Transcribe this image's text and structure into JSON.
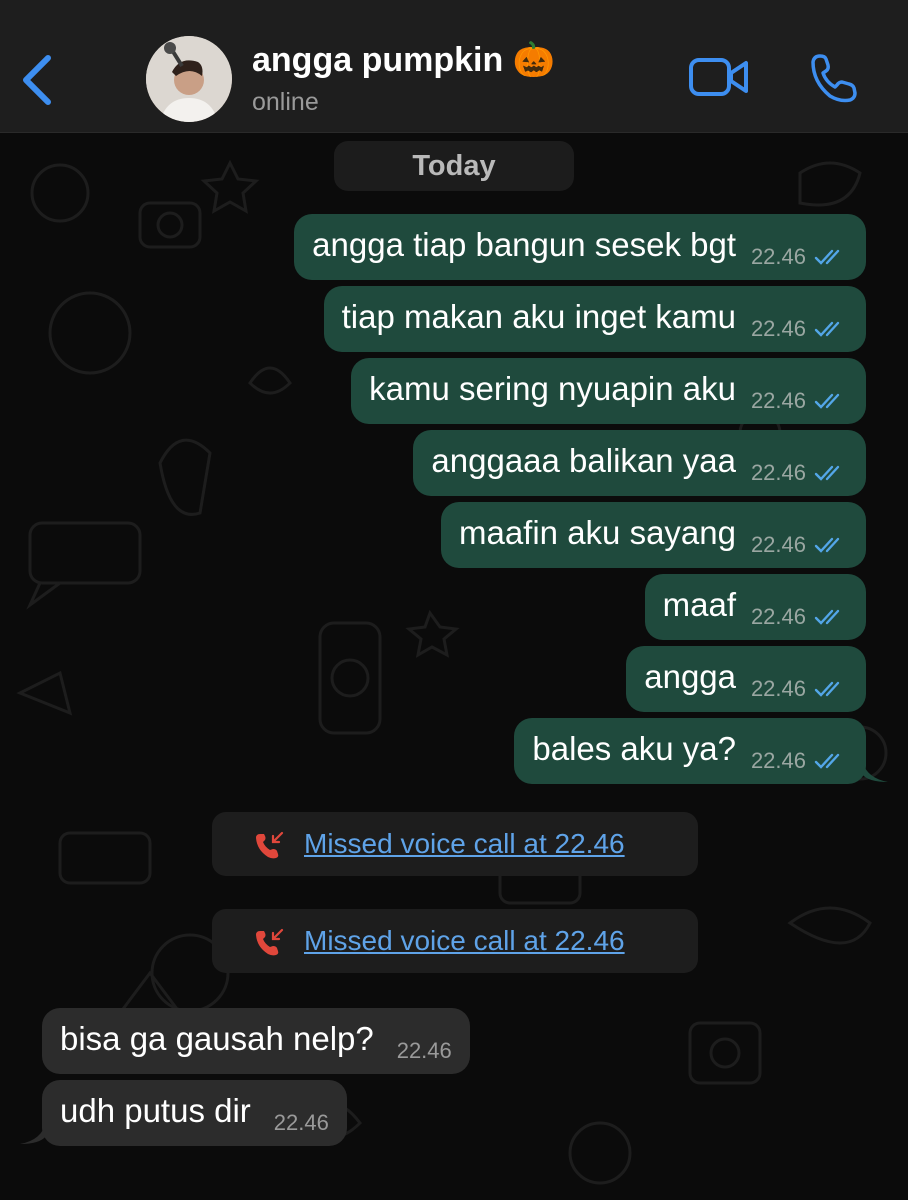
{
  "header": {
    "contact_name": "angga pumpkin 🎃",
    "status": "online"
  },
  "chat": {
    "date_label": "Today",
    "outgoing_messages": [
      {
        "text": "angga tiap bangun sesek bgt",
        "time": "22.46"
      },
      {
        "text": "tiap makan aku inget kamu",
        "time": "22.46"
      },
      {
        "text": "kamu sering nyuapin aku",
        "time": "22.46"
      },
      {
        "text": "anggaaa balikan yaa",
        "time": "22.46"
      },
      {
        "text": "maafin aku sayang",
        "time": "22.46"
      },
      {
        "text": "maaf",
        "time": "22.46"
      },
      {
        "text": "angga",
        "time": "22.46"
      },
      {
        "text": "bales aku ya?",
        "time": "22.46"
      }
    ],
    "missed_calls": [
      {
        "text": "Missed voice call at 22.46"
      },
      {
        "text": "Missed voice call at 22.46"
      }
    ],
    "incoming_messages": [
      {
        "text": "bisa ga gausah nelp?",
        "time": "22.46"
      },
      {
        "text": "udh putus dir",
        "time": "22.46"
      }
    ]
  },
  "colors": {
    "outgoing_bubble": "#1f4a3d",
    "incoming_bubble": "#2c2c2c",
    "accent_blue": "#3d8ef0",
    "missed_call_red": "#e0473b",
    "read_ticks": "#53a6e8"
  },
  "icons": {
    "back": "chevron-left-icon",
    "video": "video-camera-icon",
    "call": "phone-icon",
    "missed_call": "missed-call-icon",
    "read_receipt": "double-check-icon"
  }
}
